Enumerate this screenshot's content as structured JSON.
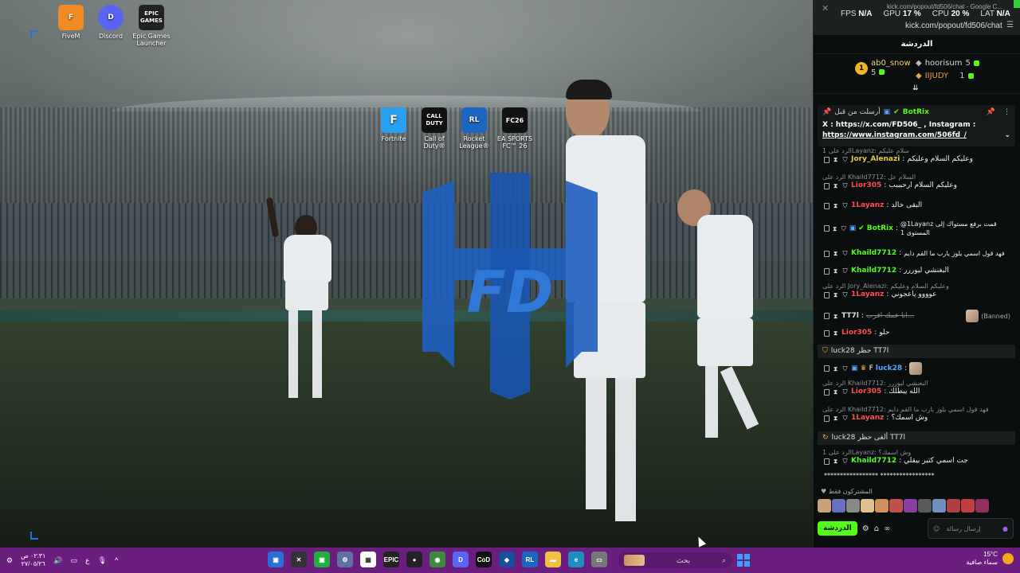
{
  "desktop": {
    "icons_top": [
      {
        "label": "FiveM",
        "color": "#f08a24",
        "glyph": "F"
      },
      {
        "label": "Discord",
        "color": "#5865f2",
        "glyph": "D"
      },
      {
        "label": "Epic Games Launcher",
        "color": "#222222",
        "glyph": "EPIC GAMES"
      }
    ],
    "icons_center": [
      {
        "label": "Fortnite",
        "color": "#2aa0f0",
        "glyph": "F"
      },
      {
        "label": "Call of Duty®",
        "color": "#111111",
        "glyph": "CALL DUTY"
      },
      {
        "label": "Rocket League®",
        "color": "#1a66c0",
        "glyph": "RL"
      },
      {
        "label": "EA SPORTS FC™ 26",
        "color": "#111111",
        "glyph": "FC26"
      }
    ],
    "wallpaper_logo_text": "FD"
  },
  "chat_window": {
    "window_title": "kick.com/popout/fd506/chat - Google C...",
    "url": "kick.com/popout/fd506/chat",
    "stats": {
      "fps_label": "FPS",
      "fps_value": "N/A",
      "gpu_label": "GPU",
      "gpu_value": "17 %",
      "cpu_label": "CPU",
      "cpu_value": "20 %",
      "lat_label": "LAT",
      "lat_value": "N/A"
    },
    "header": "الدردشة",
    "leaderboard": [
      {
        "rank": "1",
        "name": "ab0_snow",
        "count": "5"
      },
      {
        "name": "hoorisum",
        "count": "5"
      },
      {
        "name": "IIJUDY",
        "count": "1"
      }
    ],
    "pinned": {
      "by_label": "أرسلت من قبل",
      "name": "BotRix",
      "line1": "X : https://x.com/FD506_ , Instagram :",
      "line2": "https://www.instagram.com/506fd_/"
    },
    "messages": [
      {
        "reply": "الرد على 1Layanz: سلام عليكم",
        "user": "Jory_Alenazi",
        "color": "y",
        "text": "وعليكم السلام وعليكم"
      },
      {
        "reply": "الرد على Khaild7712: السلام عل",
        "user": "Lior305",
        "color": "r",
        "text": "وعليكم السلام ارحبببب"
      },
      {
        "user": "1Layanz",
        "color": "r",
        "text": "البقى خالد"
      },
      {
        "user": "BotRix",
        "color": "g",
        "text": "@1Layanz قمت برفع مستواك إلى المستوى 1"
      },
      {
        "user": "Khaild7712",
        "color": "g",
        "text": "فهد قول اسمي يلوز يارب ما القم دايم"
      },
      {
        "user": "Khaild7712",
        "color": "g",
        "text": "البغنشي ليوررر"
      },
      {
        "reply": "الرد على Jory_Alenazi: وعليكم السلام وعليكم",
        "user": "1Layanz",
        "color": "r",
        "text": "عوووو ياعجوني"
      },
      {
        "user": "TT7l",
        "color": "w",
        "text": "انا عمك اقرب...",
        "badge": "(Banned)"
      },
      {
        "user": "Lior305",
        "color": "r",
        "text": "حلو"
      },
      {
        "user": "luck28",
        "color": "b",
        "text": ""
      },
      {
        "reply": "الرد على Khaild7712: البغنشي ليوررر",
        "user": "Lior305",
        "color": "r",
        "text": "الله يبطلك"
      },
      {
        "reply": "الرد على Khaild7712: فهد قول اسمي يلوز يارب ما القم دايم",
        "user": "1Layanz",
        "color": "r",
        "text": "وش اسمك؟"
      },
      {
        "reply": "الرد على 1Layanz: وش اسمك؟",
        "user": "Khaild7712",
        "color": "g",
        "text": "جت اسمي كثير بيقلي"
      }
    ],
    "ban_notices": [
      {
        "text": "luck28 حظر TT7l"
      },
      {
        "text": "luck28 ألغى حظر TT7l"
      }
    ],
    "stars_line": "*****************  *****************",
    "subscribers_label": "المشتركون فقط",
    "input": {
      "placeholder": "إرسال رسالة",
      "chat_button": "الدردشة"
    },
    "sub_colors": [
      "#c9a27c",
      "#6b6fc2",
      "#888888",
      "#e0c090",
      "#d09060",
      "#c05050",
      "#8a3fa0",
      "#5a5a5a",
      "#7090c0",
      "#b04040",
      "#c04040",
      "#903060"
    ]
  },
  "taskbar": {
    "clock_time": "٠٢:٣١ ص",
    "clock_date": "٢٧/٠٥/٢٦",
    "lang": "ع",
    "search_placeholder": "بحث",
    "weather_temp": "15°C",
    "weather_desc": "سماء صافية",
    "apps": [
      {
        "name": "app-1",
        "color": "#2a6fd6",
        "glyph": "▣"
      },
      {
        "name": "app-2",
        "color": "#333333",
        "glyph": "✕"
      },
      {
        "name": "app-3",
        "color": "#20b040",
        "glyph": "▣"
      },
      {
        "name": "settings",
        "color": "#6070a0",
        "glyph": "⚙"
      },
      {
        "name": "store",
        "color": "#ffffff",
        "glyph": "▦"
      },
      {
        "name": "epic",
        "color": "#222222",
        "glyph": "EPIC"
      },
      {
        "name": "obs",
        "color": "#222222",
        "glyph": "●"
      },
      {
        "name": "chrome",
        "color": "#3c8a3c",
        "glyph": "◉"
      },
      {
        "name": "discord",
        "color": "#5865f2",
        "glyph": "D"
      },
      {
        "name": "cod",
        "color": "#111111",
        "glyph": "CoD"
      },
      {
        "name": "app-11",
        "color": "#1a4fa0",
        "glyph": "◆"
      },
      {
        "name": "rocket-league",
        "color": "#1a66c0",
        "glyph": "RL"
      },
      {
        "name": "explorer",
        "color": "#f0c040",
        "glyph": "▬"
      },
      {
        "name": "edge",
        "color": "#1e90c0",
        "glyph": "e"
      },
      {
        "name": "app-15",
        "color": "#777777",
        "glyph": "▭"
      }
    ]
  }
}
